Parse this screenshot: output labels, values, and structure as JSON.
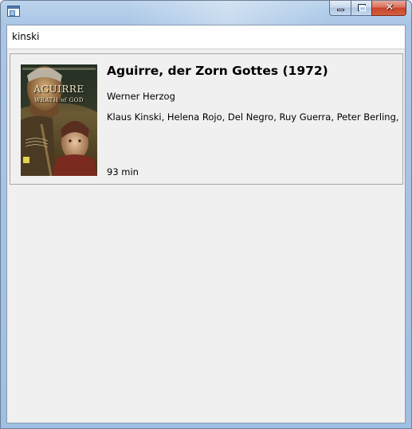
{
  "window": {
    "title": "",
    "controls": {
      "minimize_icon": "minimize-icon",
      "maximize_icon": "maximize-icon",
      "close_icon": "close-icon",
      "close_glyph": "✕"
    }
  },
  "search": {
    "value": "kinski",
    "placeholder": ""
  },
  "results": [
    {
      "title": "Aguirre, der Zorn Gottes (1972)",
      "director": "Werner Herzog",
      "cast": "Klaus Kinski, Helena Rojo, Del Negro, Ruy Guerra, Peter Berling, Cecilia",
      "runtime": "93 min",
      "poster": {
        "icon": "movie-poster",
        "title_text": "AGUIRRE",
        "subtitle_text": "WRATH of GOD"
      }
    }
  ],
  "colors": {
    "frame": "#a9c6e6",
    "client_background": "#f0f0f0",
    "close_button": "#c7452d"
  }
}
